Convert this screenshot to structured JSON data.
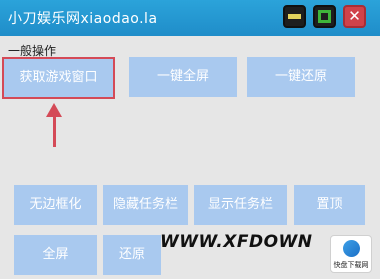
{
  "window": {
    "title": "小刀娱乐网xiaodao.la",
    "controls": {
      "minimize": "minimize",
      "maximize": "maximize",
      "close": "✕"
    },
    "accent_color": "#1f8dc9",
    "close_color": "#d0424a"
  },
  "section": {
    "label": "一般操作"
  },
  "buttons": {
    "get_game_window": "获取游戏窗口",
    "one_key_fullscreen": "一键全屏",
    "one_key_restore": "一键还原",
    "borderless": "无边框化",
    "hide_taskbar": "隐藏任务栏",
    "show_taskbar": "显示任务栏",
    "pin_top": "置顶",
    "fullscreen": "全屏",
    "restore": "还原"
  },
  "button_color": "#a9c9ef",
  "highlight_color": "#d44a57",
  "watermark": {
    "text": "WWW.XFDOWN",
    "logo_text": "快盘下载网"
  }
}
